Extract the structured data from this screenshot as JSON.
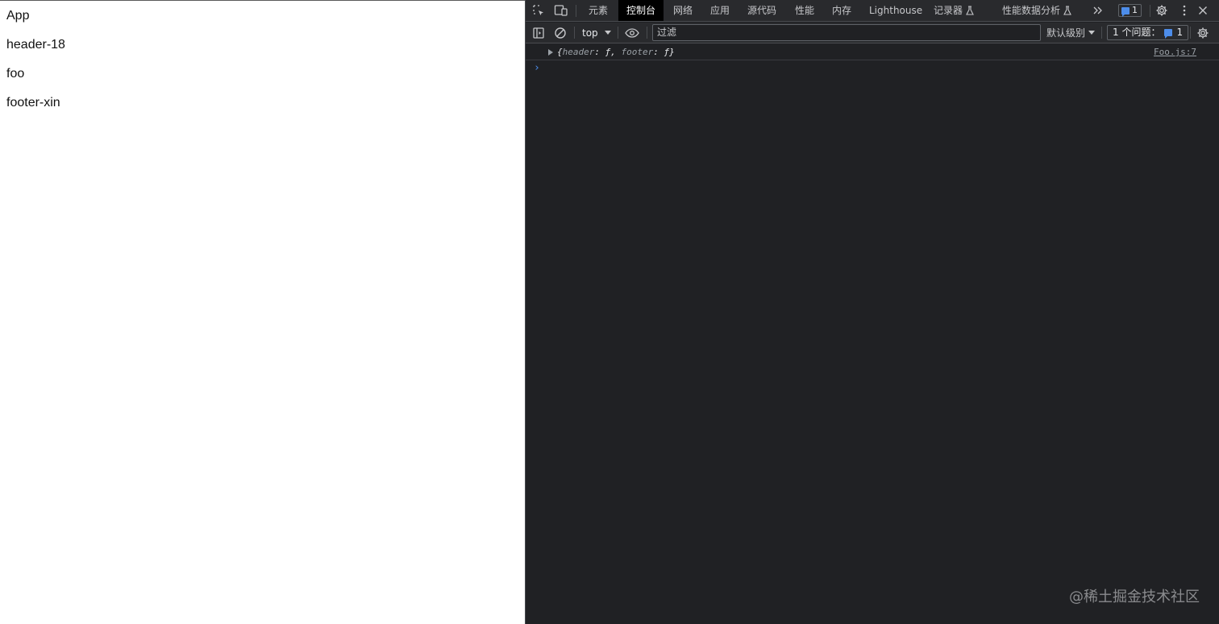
{
  "page": {
    "lines": [
      "App",
      "header-18",
      "foo",
      "footer-xin"
    ]
  },
  "devtools": {
    "tabs": [
      "元素",
      "控制台",
      "网络",
      "应用",
      "源代码",
      "性能",
      "内存",
      "Lighthouse",
      "记录器",
      "性能数据分析"
    ],
    "active_tab": "控制台",
    "more_tabs_icon": "double-chevron-right-icon",
    "messages_badge_count": "1",
    "toolbar": {
      "context": "top",
      "filter_placeholder": "过滤",
      "levels_label": "默认级别",
      "issues_label": "1 个问题：",
      "issues_count": "1"
    },
    "console": {
      "entry": {
        "open_brace": "{",
        "key1": "header",
        "sep1": ": ",
        "val1": "ƒ",
        "comma": ", ",
        "key2": "footer",
        "sep2": ": ",
        "val2": "ƒ",
        "close_brace": "}",
        "source": "Foo.js:7"
      },
      "prompt": "›"
    },
    "colors": {
      "panel_bg": "#202124",
      "toolbar_bg": "#292a2d",
      "active_tab_bg": "#000000",
      "accent": "#4d8dea"
    }
  },
  "watermark": "@稀土掘金技术社区"
}
